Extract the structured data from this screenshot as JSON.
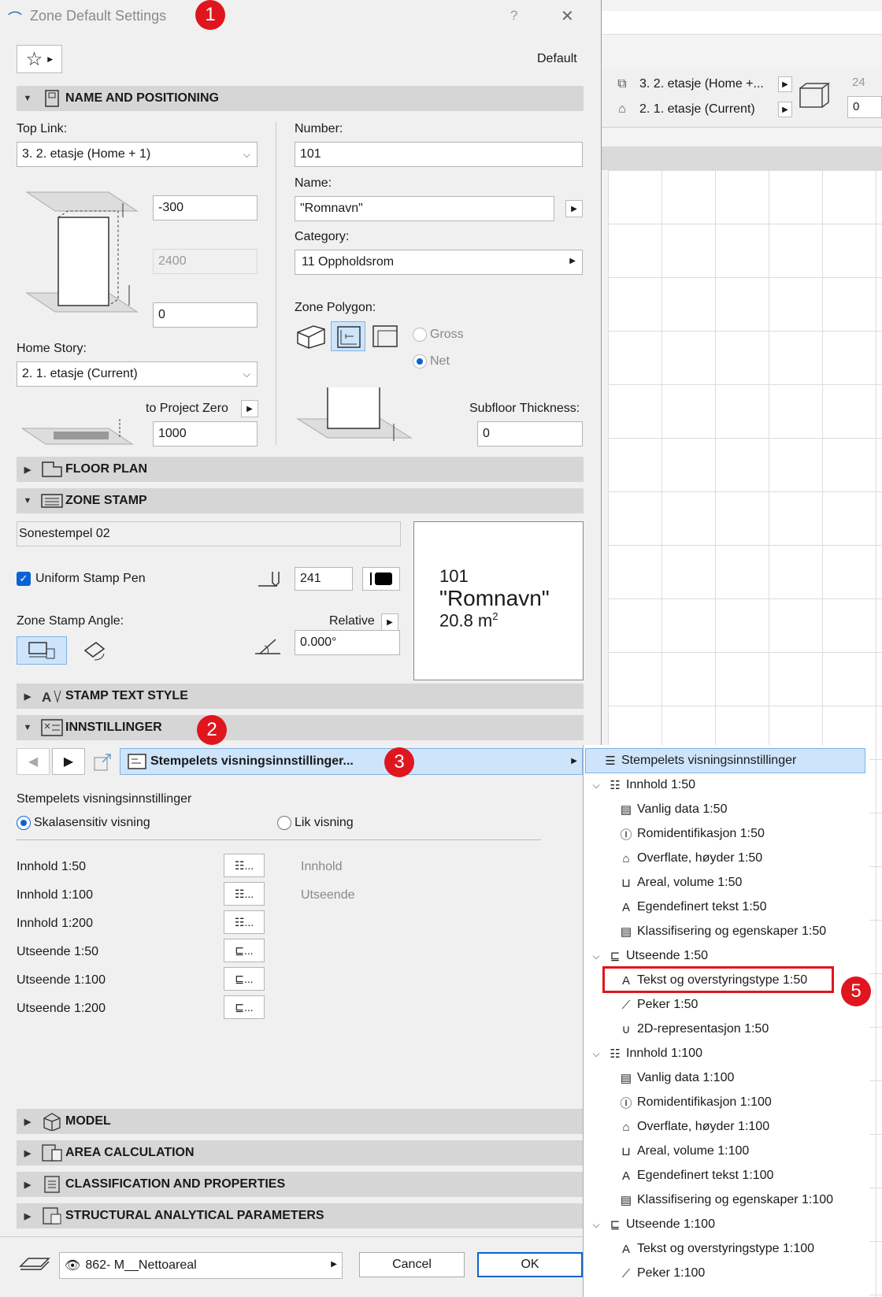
{
  "window": {
    "title": "Zone Default Settings",
    "help": "?",
    "close": "✕",
    "default_label": "Default"
  },
  "badges": [
    "1",
    "2",
    "3",
    "5"
  ],
  "right": {
    "top_link_row": "3. 2. etasje (Home +...",
    "home_row": "2. 1. etasje (Current)",
    "val1": "24",
    "val2": "0"
  },
  "sections": {
    "name_pos": "NAME AND POSITIONING",
    "floor_plan": "FLOOR PLAN",
    "zone_stamp": "ZONE STAMP",
    "stamp_text": "STAMP TEXT STYLE",
    "innstillinger": "INNSTILLINGER",
    "model": "MODEL",
    "area_calc": "AREA CALCULATION",
    "class_props": "CLASSIFICATION AND PROPERTIES",
    "struct": "STRUCTURAL ANALYTICAL PARAMETERS"
  },
  "positioning": {
    "top_link_label": "Top Link:",
    "top_link_value": "3. 2. etasje (Home + 1)",
    "top_offset": "-300",
    "height": "2400",
    "bottom_offset": "0",
    "home_story_label": "Home Story:",
    "home_story_value": "2. 1. etasje (Current)",
    "to_project_zero_label": "to Project Zero",
    "to_project_zero_value": "1000",
    "number_label": "Number:",
    "number_value": "101",
    "name_label": "Name:",
    "name_value": "\"Romnavn\"",
    "category_label": "Category:",
    "category_value": "11  Oppholdsrom",
    "zone_polygon_label": "Zone Polygon:",
    "gross_label": "Gross",
    "net_label": "Net",
    "subfloor_label": "Subfloor Thickness:",
    "subfloor_value": "0"
  },
  "stamp": {
    "name": "Sonestempel 02",
    "uniform_pen_label": "Uniform Stamp Pen",
    "pen_value": "241",
    "angle_label": "Zone Stamp Angle:",
    "relative_label": "Relative",
    "angle_value": "0.000°",
    "preview_number": "101",
    "preview_name": "\"Romnavn\"",
    "preview_area": "20.8 m",
    "preview_sup": "2"
  },
  "innst": {
    "dropdown_value": "Stempelets visningsinnstillinger...",
    "panel_title": "Stempelets visningsinnstillinger",
    "scale_label": "Skalasensitiv visning",
    "same_label": "Lik visning",
    "rows": [
      "Innhold 1:50",
      "Innhold 1:100",
      "Innhold 1:200",
      "Utseende 1:50",
      "Utseende 1:100",
      "Utseende 1:200"
    ],
    "col_innhold": "Innhold",
    "col_utseende": "Utseende",
    "btn_dots": "..."
  },
  "tree": {
    "items": [
      "Stempelets visningsinnstillinger",
      "Innhold 1:50",
      "Vanlig data 1:50",
      "Romidentifikasjon 1:50",
      "Overflate, høyder 1:50",
      "Areal, volume 1:50",
      "Egendefinert tekst 1:50",
      "Klassifisering og egenskaper 1:50",
      "Utseende 1:50",
      "Tekst og overstyringstype 1:50",
      "Peker 1:50",
      "2D-representasjon 1:50",
      "Innhold 1:100",
      "Vanlig data 1:100",
      "Romidentifikasjon 1:100",
      "Overflate, høyder 1:100",
      "Areal, volume 1:100",
      "Egendefinert tekst 1:100",
      "Klassifisering og egenskaper 1:100",
      "Utseende 1:100",
      "Tekst og overstyringstype 1:100",
      "Peker 1:100"
    ]
  },
  "footer": {
    "layer": "862- M__Nettoareal",
    "cancel": "Cancel",
    "ok": "OK"
  },
  "colors": {
    "accent": "#0a63d0",
    "badge": "#e0161e",
    "highlight_box": "#e0161e",
    "selected_bg": "#cde4fb"
  }
}
